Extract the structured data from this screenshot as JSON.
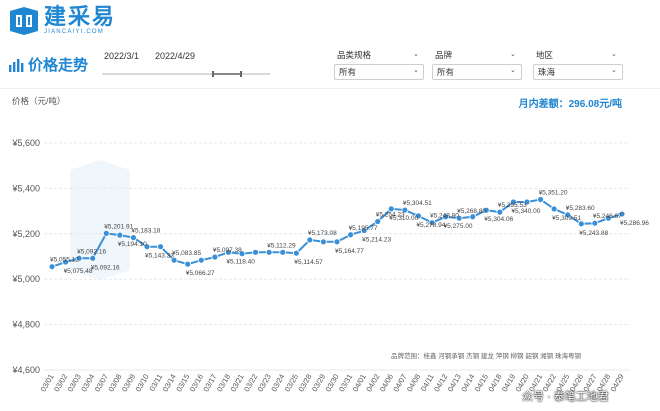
{
  "brand": {
    "name_cn": "建采易",
    "name_en": "JIANCAIYI.COM"
  },
  "page": {
    "title": "价格走势"
  },
  "date_range": {
    "start": "2022/3/1",
    "end": "2022/4/29"
  },
  "filters": [
    {
      "label": "品类规格",
      "value": "所有"
    },
    {
      "label": "品牌",
      "value": "所有"
    },
    {
      "label": "地区",
      "value": "珠海"
    }
  ],
  "summary": {
    "monthly_diff": "月内差额：296.08元/吨"
  },
  "footer_note": "品牌范围：桂鑫 河钢承钢 杰钢 建龙 萍钢 柳钢 韶钢 湘钢 珠海粤钢",
  "signature": "众号 · 泰笔工地君",
  "chart_data": {
    "type": "line",
    "ylabel": "价格（元/吨）",
    "ylim": [
      4600,
      5600
    ],
    "yticks": [
      4600,
      4800,
      5000,
      5200,
      5400,
      5600
    ],
    "ytick_labels": [
      "¥4,600",
      "¥4,800",
      "¥5,000",
      "¥5,200",
      "¥5,400",
      "¥5,600"
    ],
    "grid": true,
    "color": "#3a8fd6",
    "categories": [
      "03/01",
      "03/02",
      "03/03",
      "03/04",
      "03/07",
      "03/08",
      "03/09",
      "03/10",
      "03/11",
      "03/14",
      "03/15",
      "03/16",
      "03/17",
      "03/18",
      "03/21",
      "03/22",
      "03/23",
      "03/24",
      "03/25",
      "03/28",
      "03/29",
      "03/30",
      "03/31",
      "04/01",
      "04/02",
      "04/06",
      "04/07",
      "04/08",
      "04/11",
      "04/12",
      "04/13",
      "04/14",
      "04/15",
      "04/18",
      "04/19",
      "04/20",
      "04/21",
      "04/22",
      "04/25",
      "04/26",
      "04/27",
      "04/28",
      "04/29"
    ],
    "values": [
      5055.12,
      5075.48,
      5092.16,
      5092.16,
      5201.91,
      5194.1,
      5183.18,
      5143.33,
      5143.33,
      5083.85,
      5066.27,
      5083.85,
      5097.38,
      5118.4,
      5112.29,
      5118.4,
      5118.4,
      5118.4,
      5114.57,
      5173.08,
      5164.77,
      5164.77,
      5195.77,
      5214.23,
      5254.23,
      5310.0,
      5304.51,
      5278.94,
      5248.8,
      5275.0,
      5268.8,
      5275.0,
      5304.06,
      5295.53,
      5340.0,
      5340.0,
      5351.2,
      5309.51,
      5283.6,
      5243.88,
      5246.67,
      5268.8,
      5286.96
    ],
    "data_labels": [
      {
        "i": 0,
        "text": "¥5,055.12"
      },
      {
        "i": 1,
        "text": "¥5,075.48"
      },
      {
        "i": 2,
        "text": "¥5,092.16"
      },
      {
        "i": 3,
        "text": "¥5,092.16"
      },
      {
        "i": 4,
        "text": "¥5,201.91"
      },
      {
        "i": 5,
        "text": "¥5,194.10"
      },
      {
        "i": 6,
        "text": "¥5,183.18"
      },
      {
        "i": 7,
        "text": "¥5,143.33"
      },
      {
        "i": 9,
        "text": "¥5,083.85"
      },
      {
        "i": 10,
        "text": "¥5,066.27"
      },
      {
        "i": 12,
        "text": "¥5,097.38"
      },
      {
        "i": 13,
        "text": "¥5,118.40"
      },
      {
        "i": 16,
        "text": "¥5,112.29"
      },
      {
        "i": 18,
        "text": "¥5,114.57"
      },
      {
        "i": 19,
        "text": "¥5,173.08"
      },
      {
        "i": 21,
        "text": "¥5,164.77"
      },
      {
        "i": 22,
        "text": "¥5,195.77"
      },
      {
        "i": 23,
        "text": "¥5,214.23"
      },
      {
        "i": 24,
        "text": "¥5,254.23"
      },
      {
        "i": 25,
        "text": "¥5,310.00"
      },
      {
        "i": 26,
        "text": "¥5,304.51"
      },
      {
        "i": 27,
        "text": "¥5,278.94"
      },
      {
        "i": 28,
        "text": "¥5,248.80"
      },
      {
        "i": 29,
        "text": "¥5,275.00"
      },
      {
        "i": 30,
        "text": "¥5,268.80"
      },
      {
        "i": 32,
        "text": "¥5,304.06"
      },
      {
        "i": 33,
        "text": "¥5,295.53"
      },
      {
        "i": 34,
        "text": "¥5,340.00"
      },
      {
        "i": 36,
        "text": "¥5,351.20"
      },
      {
        "i": 37,
        "text": "¥5,309.51"
      },
      {
        "i": 38,
        "text": "¥5,283.60"
      },
      {
        "i": 39,
        "text": "¥5,243.88"
      },
      {
        "i": 40,
        "text": "¥5,246.67"
      },
      {
        "i": 42,
        "text": "¥5,286.96"
      }
    ]
  }
}
